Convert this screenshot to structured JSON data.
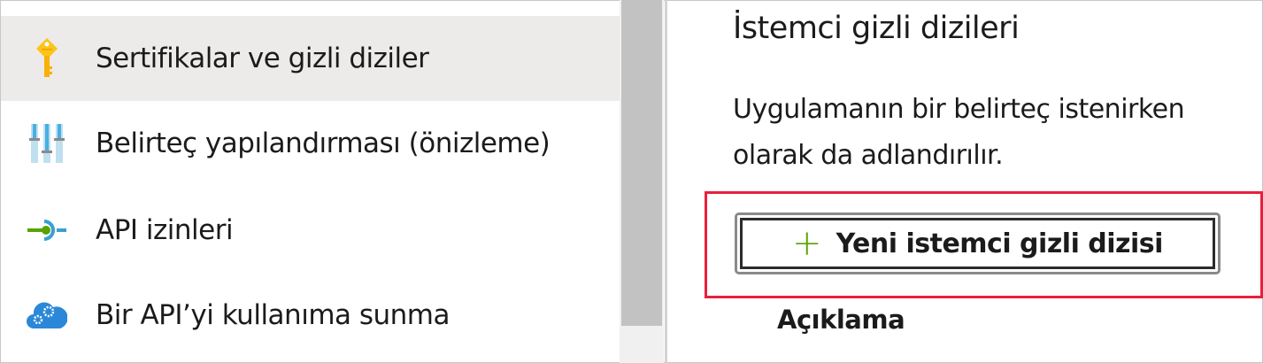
{
  "sidebar": {
    "items": [
      {
        "label": "Sertifikalar ve gizli diziler",
        "icon": "key-icon",
        "selected": true
      },
      {
        "label": "Belirteç yapılandırması (önizleme)",
        "icon": "sliders-icon"
      },
      {
        "label": "API izinleri",
        "icon": "api-permissions-icon"
      },
      {
        "label": "Bir API’yi kullanıma sunma",
        "icon": "cloud-gears-icon"
      }
    ]
  },
  "main": {
    "title": "İstemci gizli dizileri",
    "desc_line1": "Uygulamanın bir belirteç istenirken",
    "desc_line2": "olarak da adlandırılır.",
    "new_button": "Yeni istemci gizli dizisi",
    "column_header": "Açıklama"
  },
  "colors": {
    "highlight": "#e8203d",
    "plus": "#57a300",
    "selected_bg": "#edebe9"
  }
}
